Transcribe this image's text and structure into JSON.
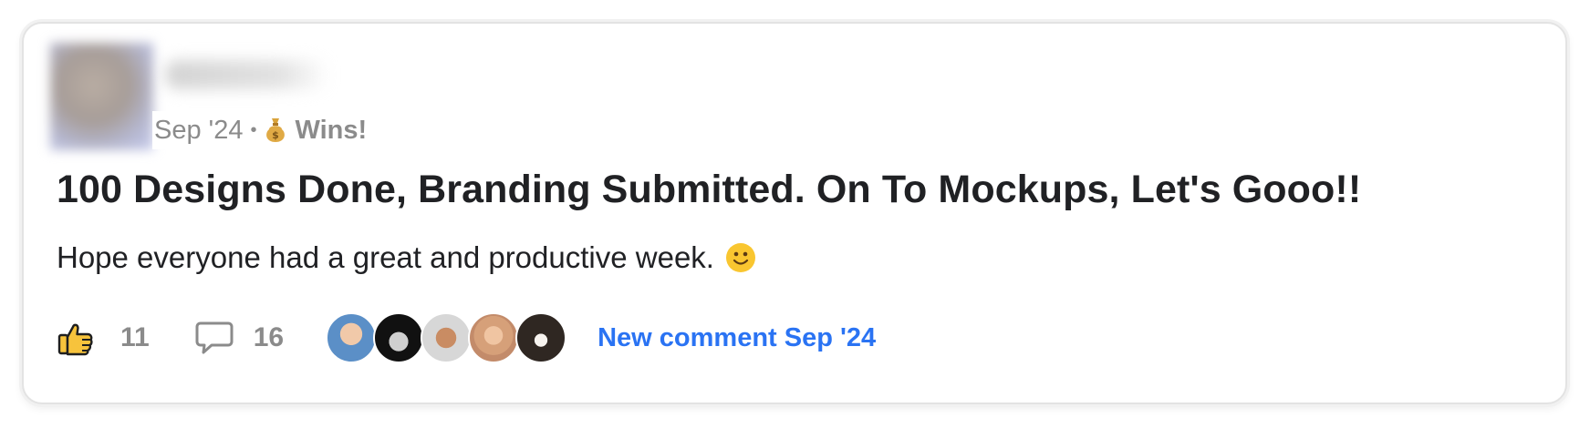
{
  "post": {
    "date": "Sep '24",
    "separator": "•",
    "category_icon": "money-bag-icon",
    "category": "Wins!",
    "title": "100 Designs Done, Branding Submitted. On To Mockups, Let's Gooo!!",
    "body": "Hope everyone had a great and productive week.",
    "body_icon": "slightly-smiling-face-icon"
  },
  "actions": {
    "like_count": "11",
    "comment_count": "16",
    "new_comment_label": "New comment Sep '24"
  },
  "colors": {
    "link": "#2a73f3",
    "text": "#202124",
    "muted": "#8b8b8b",
    "thumb": "#f7c33c"
  }
}
